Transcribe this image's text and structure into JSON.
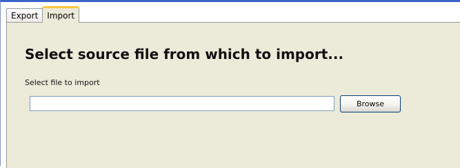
{
  "tabs": [
    {
      "label": "Export",
      "active": false
    },
    {
      "label": "Import",
      "active": true
    }
  ],
  "import_panel": {
    "title": "Select source file from which to import...",
    "field_label": "Select file to import",
    "file_input_value": "",
    "browse_label": "Browse"
  },
  "colors": {
    "panel_background": "#ecead8",
    "active_tab_accent": "#ffc83c",
    "window_border": "#3c63c8"
  }
}
